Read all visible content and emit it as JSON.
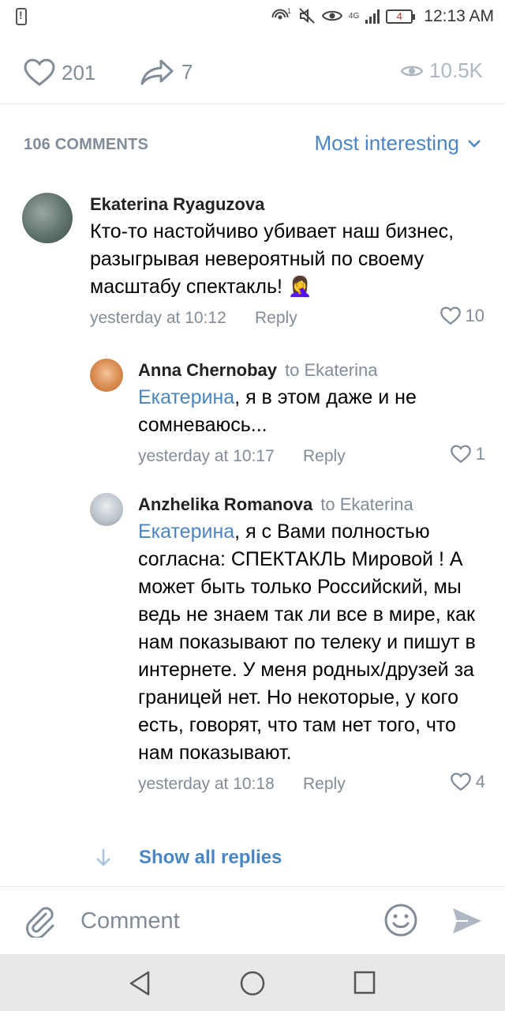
{
  "status_bar": {
    "time": "12:13 AM",
    "battery": "4",
    "network": "4G",
    "icons": [
      "alert-icon",
      "hotspot-icon",
      "mute-icon",
      "eye-icon",
      "signal-icon",
      "battery-icon"
    ]
  },
  "post_actions": {
    "likes": "201",
    "shares": "7",
    "views": "10.5K"
  },
  "comments_header": {
    "count_label": "106 COMMENTS",
    "sort_label": "Most interesting"
  },
  "comments": [
    {
      "author": "Ekaterina Ryaguzova",
      "to": "",
      "mention": "",
      "text": "Кто-то настойчиво убивает наш бизнес, разыгрывая невероятный по своему масштабу спектакль! 🤦‍♀️",
      "time": "yesterday at 10:12",
      "reply_label": "Reply",
      "likes": "10"
    },
    {
      "author": "Anna Chernobay",
      "to": "to Ekaterina",
      "mention": "Екатерина",
      "text": ", я в этом даже и не сомневаюсь...",
      "time": "yesterday at 10:17",
      "reply_label": "Reply",
      "likes": "1"
    },
    {
      "author": "Anzhelika Romanova",
      "to": "to Ekaterina",
      "mention": "Екатерина",
      "text": ", я с Вами полностью согласна: СПЕКТАКЛЬ Мировой ! А может быть только Российский, мы ведь не знаем так ли все в мире, как нам показывают по телеку и пишут в интернете. У меня родных/друзей за границей нет. Но некоторые, у кого есть, говорят, что там нет того, что нам показывают.",
      "time": "yesterday at 10:18",
      "reply_label": "Reply",
      "likes": "4"
    }
  ],
  "show_all_replies": "Show all replies",
  "composer": {
    "placeholder": "Comment"
  },
  "colors": {
    "accent": "#4a86c5",
    "muted": "#818c99",
    "divider": "#e7e8ec",
    "navbar": "#e8e8e8"
  }
}
